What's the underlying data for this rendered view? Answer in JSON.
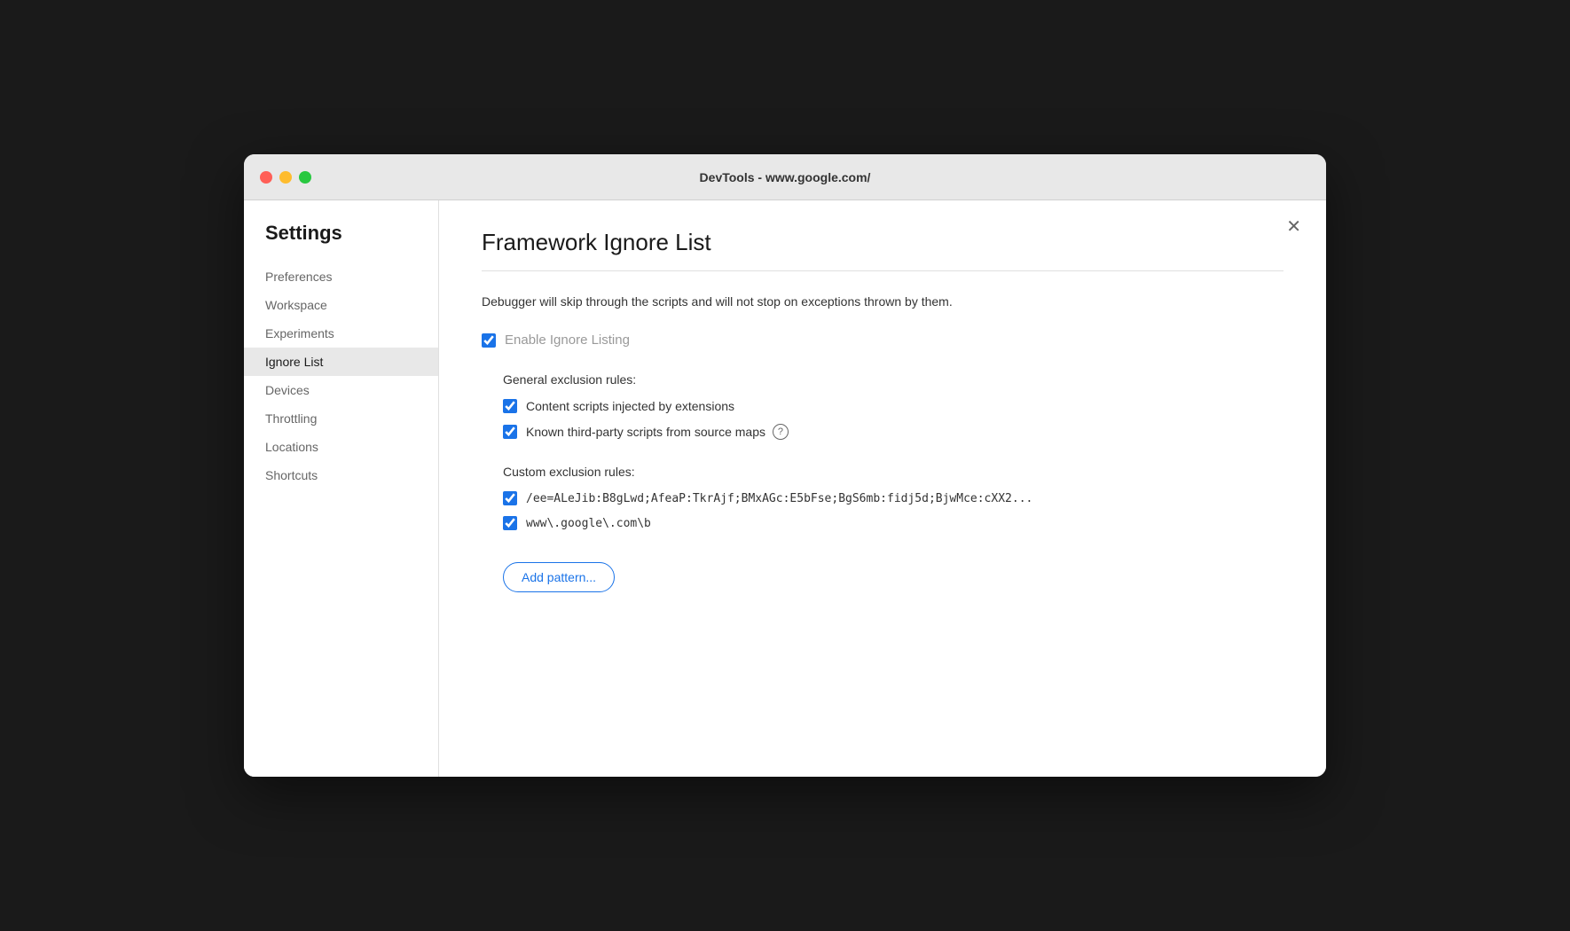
{
  "titlebar": {
    "title": "DevTools - www.google.com/"
  },
  "sidebar": {
    "heading": "Settings",
    "items": [
      {
        "id": "preferences",
        "label": "Preferences",
        "active": false
      },
      {
        "id": "workspace",
        "label": "Workspace",
        "active": false
      },
      {
        "id": "experiments",
        "label": "Experiments",
        "active": false
      },
      {
        "id": "ignore-list",
        "label": "Ignore List",
        "active": true
      },
      {
        "id": "devices",
        "label": "Devices",
        "active": false
      },
      {
        "id": "throttling",
        "label": "Throttling",
        "active": false
      },
      {
        "id": "locations",
        "label": "Locations",
        "active": false
      },
      {
        "id": "shortcuts",
        "label": "Shortcuts",
        "active": false
      }
    ]
  },
  "main": {
    "title": "Framework Ignore List",
    "description": "Debugger will skip through the scripts and will not stop on exceptions thrown by them.",
    "enable_ignore_listing_label": "Enable Ignore Listing",
    "enable_ignore_listing_checked": true,
    "general_exclusion_label": "General exclusion rules:",
    "general_rules": [
      {
        "id": "content-scripts",
        "label": "Content scripts injected by extensions",
        "checked": true,
        "has_help": false
      },
      {
        "id": "known-third-party",
        "label": "Known third-party scripts from source maps",
        "checked": true,
        "has_help": true
      }
    ],
    "custom_exclusion_label": "Custom exclusion rules:",
    "custom_rules": [
      {
        "id": "rule1",
        "value": "/ee=ALeJib:B8gLwd;AfeaP:TkrAjf;BMxAGc:E5bFse;BgS6mb:fidj5d;BjwMce:cXX2...",
        "checked": true
      },
      {
        "id": "rule2",
        "value": "www\\.google\\.com\\b",
        "checked": true
      }
    ],
    "add_pattern_label": "Add pattern..."
  },
  "close_button": "✕"
}
